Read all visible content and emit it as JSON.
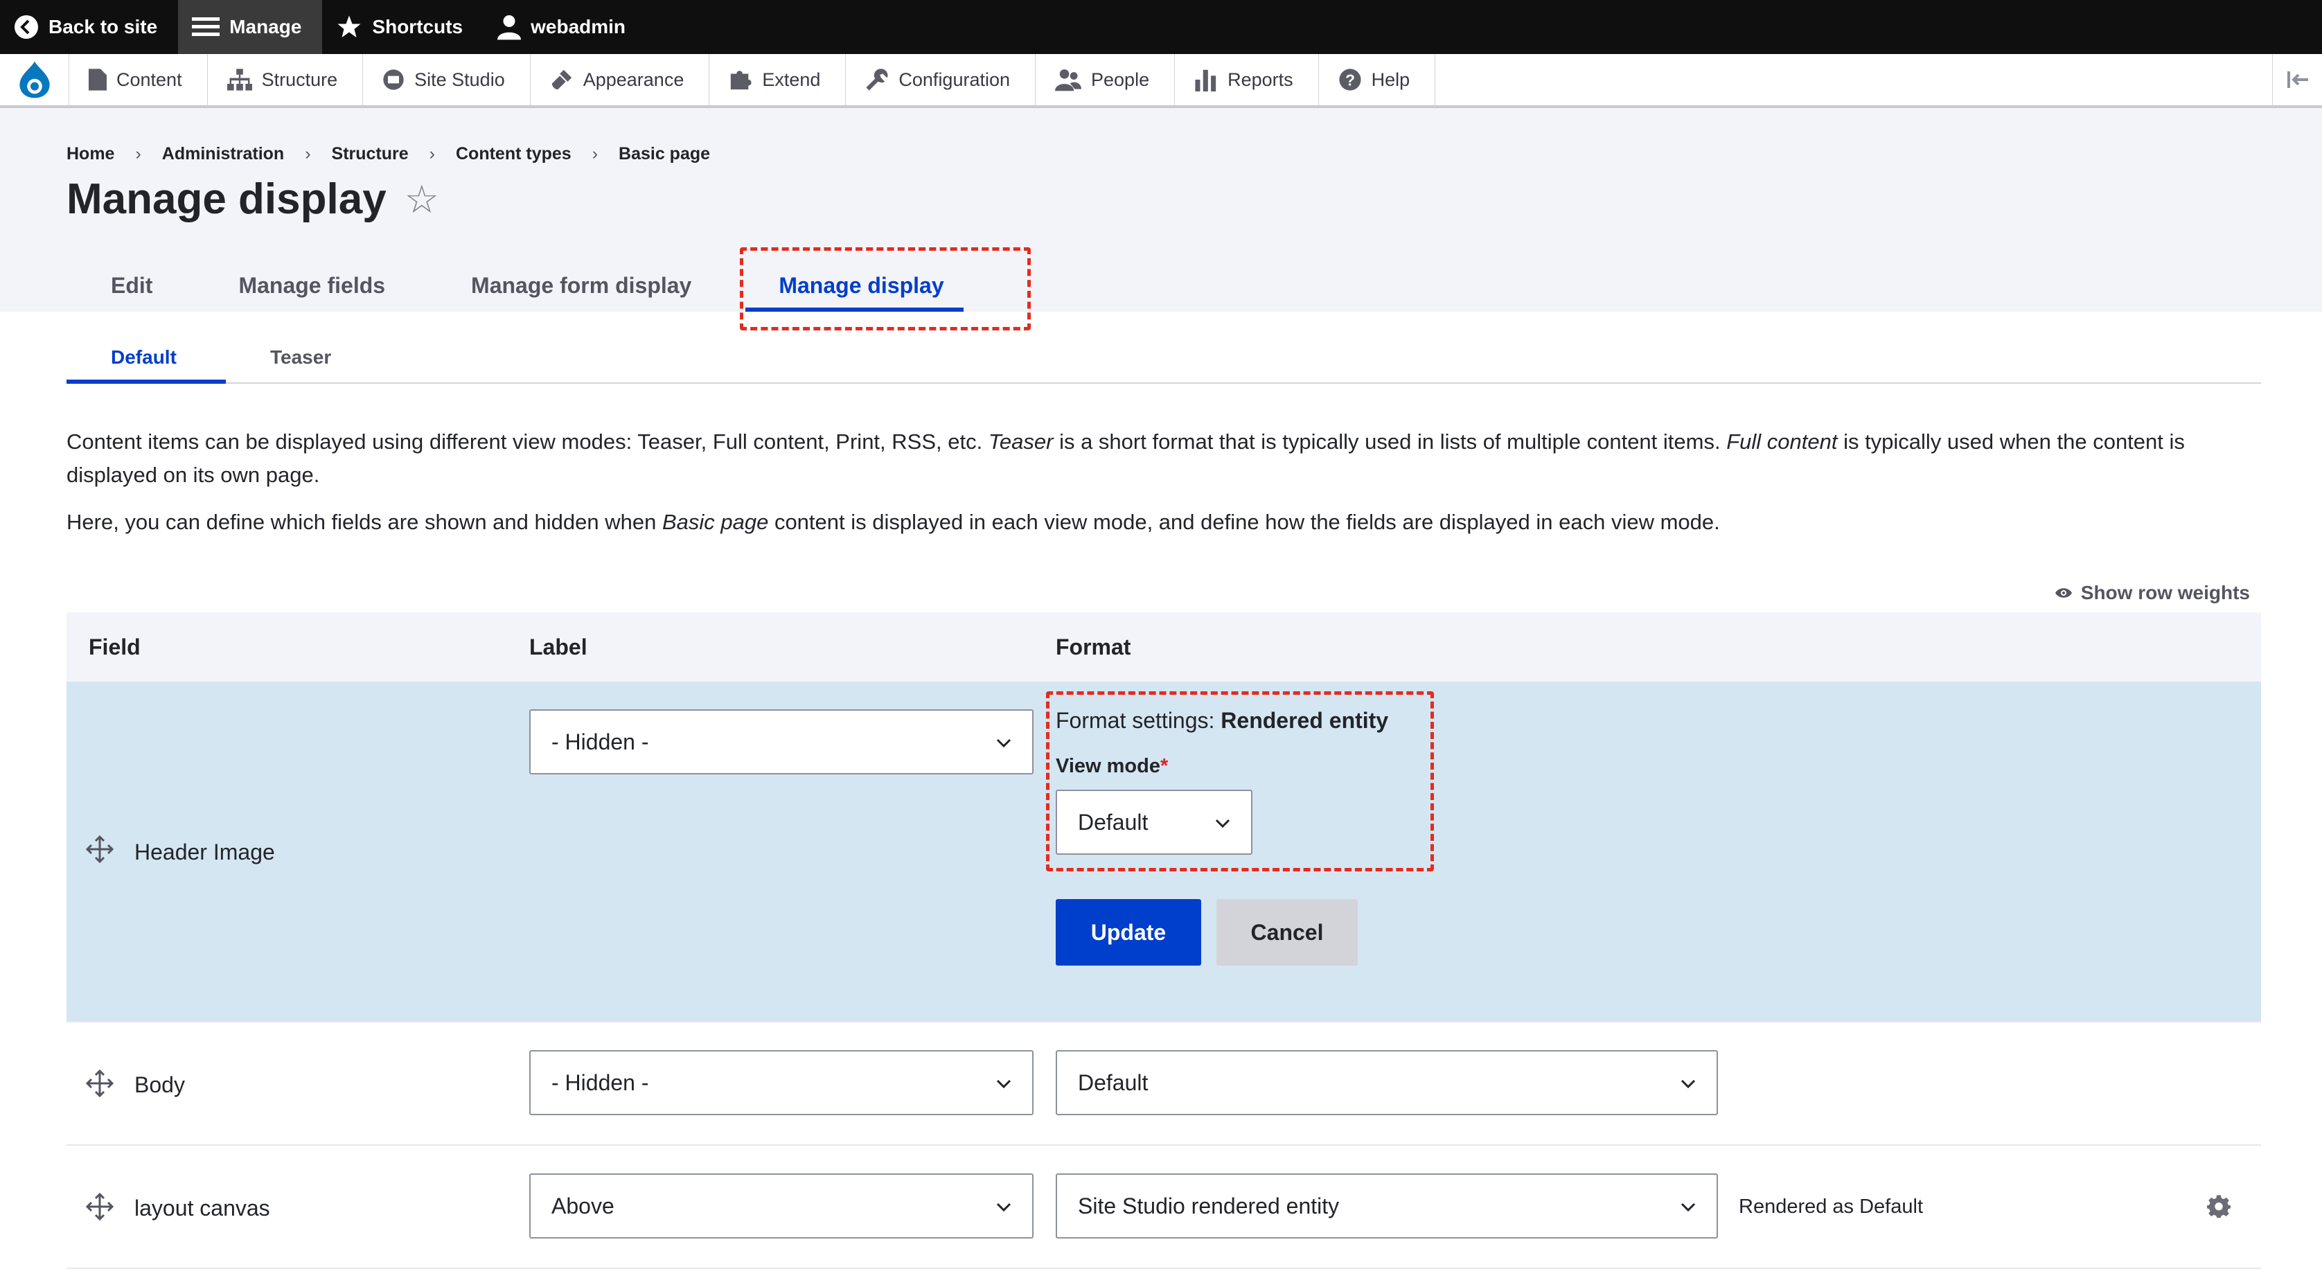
{
  "toolbar": {
    "back_label": "Back to site",
    "manage_label": "Manage",
    "shortcuts_label": "Shortcuts",
    "user_label": "webadmin"
  },
  "admin_menu": {
    "items": [
      {
        "label": "Content",
        "icon": "file-icon"
      },
      {
        "label": "Structure",
        "icon": "sitemap-icon"
      },
      {
        "label": "Site Studio",
        "icon": "site-studio-icon"
      },
      {
        "label": "Appearance",
        "icon": "paintbrush-icon"
      },
      {
        "label": "Extend",
        "icon": "puzzle-icon"
      },
      {
        "label": "Configuration",
        "icon": "wrench-icon"
      },
      {
        "label": "People",
        "icon": "people-icon"
      },
      {
        "label": "Reports",
        "icon": "bar-chart-icon"
      },
      {
        "label": "Help",
        "icon": "help-icon"
      }
    ]
  },
  "breadcrumb": [
    "Home",
    "Administration",
    "Structure",
    "Content types",
    "Basic page"
  ],
  "page_title": "Manage display",
  "primary_tabs": [
    {
      "label": "Edit",
      "active": false
    },
    {
      "label": "Manage fields",
      "active": false
    },
    {
      "label": "Manage form display",
      "active": false
    },
    {
      "label": "Manage display",
      "active": true
    }
  ],
  "secondary_tabs": [
    {
      "label": "Default",
      "active": true
    },
    {
      "label": "Teaser",
      "active": false
    }
  ],
  "description": {
    "p1_a": "Content items can be displayed using different view modes: Teaser, Full content, Print, RSS, etc. ",
    "p1_em1": "Teaser",
    "p1_b": " is a short format that is typically used in lists of multiple content items. ",
    "p1_em2": "Full content",
    "p1_c": " is typically used when the content is displayed on its own page.",
    "p2_a": "Here, you can define which fields are shown and hidden when ",
    "p2_em": "Basic page",
    "p2_b": " content is displayed in each view mode, and define how the fields are displayed in each view mode."
  },
  "show_row_weights": "Show row weights",
  "table": {
    "headers": {
      "field": "Field",
      "label": "Label",
      "format": "Format"
    },
    "rows": [
      {
        "field": "Header Image",
        "label_value": "- Hidden -",
        "format_settings_prefix": "Format settings: ",
        "format_settings_name": "Rendered entity",
        "view_mode_label": "View mode",
        "required_mark": "*",
        "view_mode_value": "Default",
        "update_label": "Update",
        "cancel_label": "Cancel"
      },
      {
        "field": "Body",
        "label_value": "- Hidden -",
        "format_value": "Default"
      },
      {
        "field": "layout canvas",
        "label_value": "Above",
        "format_value": "Site Studio rendered entity",
        "summary": "Rendered as Default"
      }
    ]
  }
}
